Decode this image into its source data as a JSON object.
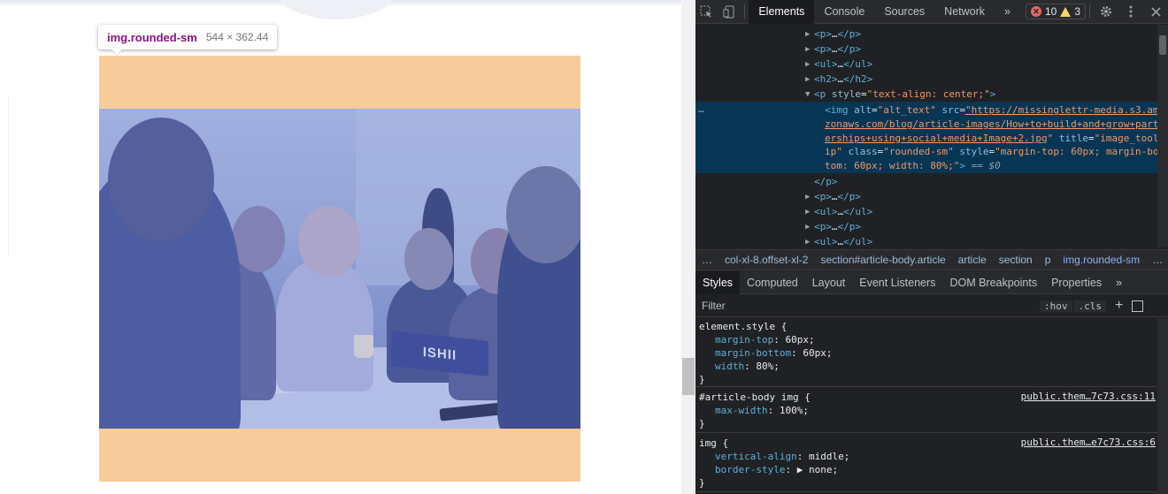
{
  "tooltip": {
    "tag": "img.rounded-sm",
    "dims": "544 × 362.44"
  },
  "photo": {
    "nameplate": "ISHII"
  },
  "devtools": {
    "tabs": [
      {
        "label": "Elements",
        "active": true
      },
      {
        "label": "Console",
        "active": false
      },
      {
        "label": "Sources",
        "active": false
      },
      {
        "label": "Network",
        "active": false
      }
    ],
    "more_tabs": "»",
    "errors": "10",
    "warnings": "3",
    "dom_lines": [
      {
        "open": "<p>",
        "dots": "…",
        "close": "</p>"
      },
      {
        "open": "<p>",
        "dots": "…",
        "close": "</p>"
      },
      {
        "open": "<ul>",
        "dots": "…",
        "close": "</ul>"
      },
      {
        "open": "<h2>",
        "dots": "…",
        "close": "</h2>"
      }
    ],
    "p_open": {
      "tag": "<p",
      "attr": "style",
      "value": "\"text-align: center;\"",
      "end": ">"
    },
    "selected": {
      "ellipsis": "…",
      "line1_tag": "<img",
      "line1_alt_n": "alt",
      "line1_alt_v": "\"alt_text\"",
      "line1_src_n": "src",
      "line1_src_v": "\"https://missinglettr-media.s3.am",
      "line2": "zonaws.com/blog/article-images/How+to+build+and+grow+part",
      "line3_link": "erships+using+social+media+Image+2.jpg",
      "line3_quote": "\"",
      "line3_title_n": "title",
      "line3_title_v": "\"image_tool",
      "line4_a": "ip\"",
      "line4_class_n": "class",
      "line4_class_v": "\"rounded-sm\"",
      "line4_style_n": "style",
      "line4_style_v": "\"margin-top: 60px; margin-bo",
      "line5_v": "tom: 60px; width: 80%;\"",
      "line5_end": ">",
      "line5_eq": "==",
      "line5_dollar": "$0"
    },
    "p_close": "</p>",
    "dom_lines_after": [
      {
        "open": "<p>",
        "dots": "…",
        "close": "</p>"
      },
      {
        "open": "<ul>",
        "dots": "…",
        "close": "</ul>"
      },
      {
        "open": "<p>",
        "dots": "…",
        "close": "</p>"
      },
      {
        "open": "<ul>",
        "dots": "…",
        "close": "</ul>"
      }
    ],
    "breadcrumbs": [
      "…",
      "col-xl-8.offset-xl-2",
      "section#article-body.article",
      "article",
      "section",
      "p",
      "img.rounded-sm",
      "…"
    ],
    "sub_tabs": [
      {
        "label": "Styles",
        "active": true
      },
      {
        "label": "Computed",
        "active": false
      },
      {
        "label": "Layout",
        "active": false
      },
      {
        "label": "Event Listeners",
        "active": false
      },
      {
        "label": "DOM Breakpoints",
        "active": false
      },
      {
        "label": "Properties",
        "active": false
      }
    ],
    "sub_more": "»",
    "filter_placeholder": "Filter",
    "hov": ":hov",
    "cls": ".cls",
    "rules": [
      {
        "selector": "element.style {",
        "source": "",
        "props": [
          {
            "name": "margin-top",
            "value": "60px;"
          },
          {
            "name": "margin-bottom",
            "value": "60px;"
          },
          {
            "name": "width",
            "value": "80%;"
          }
        ]
      },
      {
        "selector": "#article-body img {",
        "source": "public.them…7c73.css:11",
        "props": [
          {
            "name": "max-width",
            "value": "100%;"
          }
        ]
      },
      {
        "selector": "img {",
        "source": "public.them…e7c73.css:6",
        "props": [
          {
            "name": "vertical-align",
            "value": "middle;"
          },
          {
            "name": "border-style",
            "value": "▶ none;"
          }
        ]
      }
    ],
    "close_brace": "}"
  },
  "colors": {
    "margin_overlay": "#f8cb9a",
    "selection": "#073655",
    "tag": "#5db0d7",
    "attr_value": "#f29766"
  }
}
